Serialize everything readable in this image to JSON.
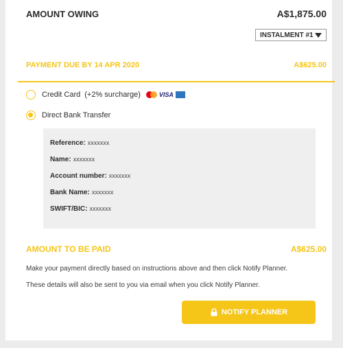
{
  "amount_owing": {
    "label": "AMOUNT OWING",
    "value": "A$1,875.00"
  },
  "instalment_select": {
    "selected": "INSTALMENT #1"
  },
  "payment_due": {
    "label": "PAYMENT DUE BY 14 APR 2020",
    "value": "A$625.00"
  },
  "payment_options": [
    {
      "label": "Credit Card",
      "surcharge": "(+2% surcharge)",
      "selected": false,
      "card_icons": [
        "mastercard-icon",
        "visa-icon",
        "amex-icon"
      ],
      "visa_text": "VISA"
    },
    {
      "label": "Direct Bank Transfer",
      "selected": true
    }
  ],
  "bank_details": {
    "reference": {
      "label": "Reference:",
      "value": "xxxxxxx"
    },
    "name": {
      "label": "Name:",
      "value": "xxxxxxx"
    },
    "account_number": {
      "label": "Account number:",
      "value": "xxxxxxx"
    },
    "bank_name": {
      "label": "Bank Name:",
      "value": "xxxxxxx"
    },
    "swift_bic": {
      "label": "SWIFT/BIC:",
      "value": "xxxxxxx"
    }
  },
  "amount_to_be_paid": {
    "label": "AMOUNT TO BE PAID",
    "value": "A$625.00"
  },
  "instructions": [
    "Make your payment directly based on instructions above and then click Notify Planner.",
    "These details will also be sent to you via email when you click Notify Planner."
  ],
  "notify_button": {
    "label": "NOTIFY PLANNER",
    "icon": "lock-icon"
  },
  "colors": {
    "accent": "#f5c518",
    "text": "#2b2b2b",
    "background": "#ececec",
    "panel": "#ffffff"
  }
}
